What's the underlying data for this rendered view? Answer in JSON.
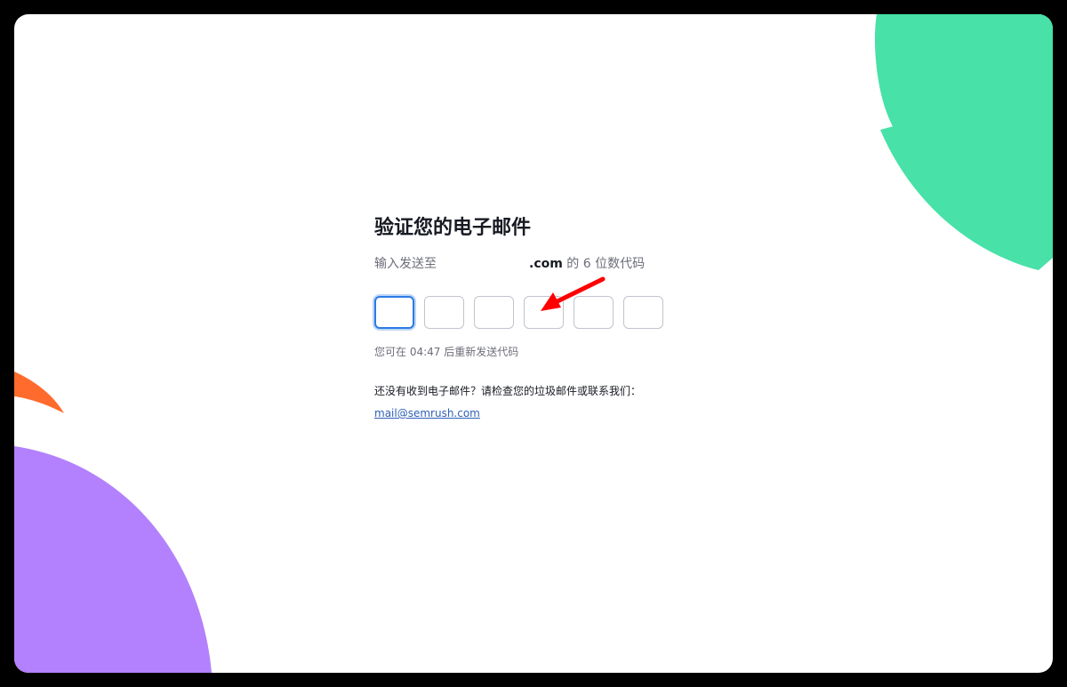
{
  "verify": {
    "title": "验证您的电子邮件",
    "subtitle_prefix": "输入发送至",
    "email_masked": ".com",
    "subtitle_suffix": " 的 6 位数代码",
    "code_digits": [
      "",
      "",
      "",
      "",
      "",
      ""
    ],
    "resend_text": "您可在 04:47 后重新发送代码",
    "help_text": "还没有收到电子邮件？请检查您的垃圾邮件或联系我们：",
    "support_email": "mail@semrush.com"
  },
  "colors": {
    "green_shape": "#48e1a8",
    "purple_shape": "#b381fd",
    "orange_shape": "#ff6b2c",
    "annotation_arrow": "#ff0000",
    "focus_border": "#2d7ae6"
  }
}
